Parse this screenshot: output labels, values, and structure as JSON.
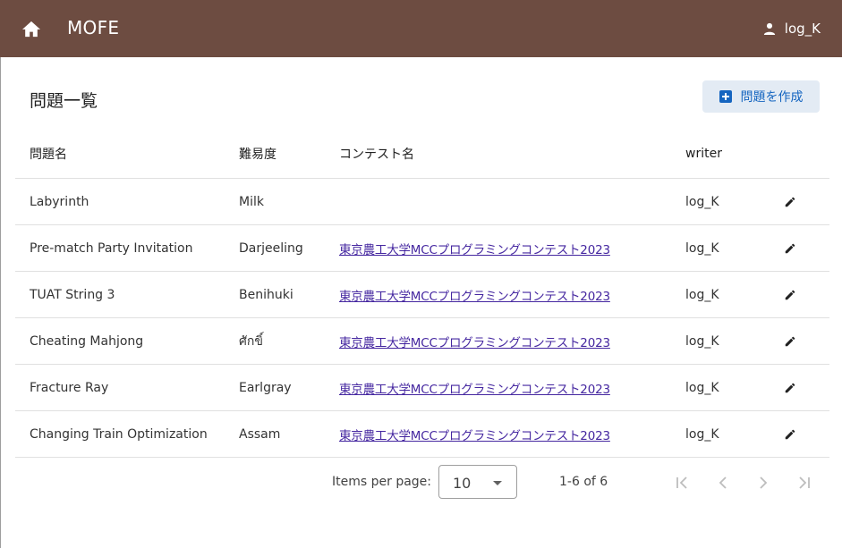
{
  "header": {
    "app_title": "MOFE",
    "user_name": "log_K"
  },
  "page": {
    "heading": "問題一覧",
    "create_button_label": "問題を作成"
  },
  "table": {
    "columns": [
      "問題名",
      "難易度",
      "コンテスト名",
      "writer"
    ],
    "rows": [
      {
        "name": "Labyrinth",
        "difficulty": "Milk",
        "contest": "",
        "writer": "log_K"
      },
      {
        "name": "Pre-match Party Invitation",
        "difficulty": "Darjeeling",
        "contest": "東京農工大学MCCプログラミングコンテスト2023",
        "writer": "log_K"
      },
      {
        "name": "TUAT String 3",
        "difficulty": "Benihuki",
        "contest": "東京農工大学MCCプログラミングコンテスト2023",
        "writer": "log_K"
      },
      {
        "name": "Cheating Mahjong",
        "difficulty": "ศักขิ์",
        "contest": "東京農工大学MCCプログラミングコンテスト2023",
        "writer": "log_K"
      },
      {
        "name": "Fracture Ray",
        "difficulty": "Earlgray",
        "contest": "東京農工大学MCCプログラミングコンテスト2023",
        "writer": "log_K"
      },
      {
        "name": "Changing Train Optimization",
        "difficulty": "Assam",
        "contest": "東京農工大学MCCプログラミングコンテスト2023",
        "writer": "log_K"
      }
    ]
  },
  "paginator": {
    "items_per_page_label": "Items per page:",
    "items_per_page_value": "10",
    "range_label": "1-6 of 6"
  },
  "icons": {
    "home": "home-icon",
    "user": "person-icon",
    "create": "add-box-icon",
    "edit": "pencil-icon",
    "first": "first-page-icon",
    "prev": "chevron-left-icon",
    "next": "chevron-right-icon",
    "last": "last-page-icon"
  },
  "colors": {
    "topbar": "#6d4c41",
    "accent": "#1565c0",
    "link": "#4527a0"
  }
}
